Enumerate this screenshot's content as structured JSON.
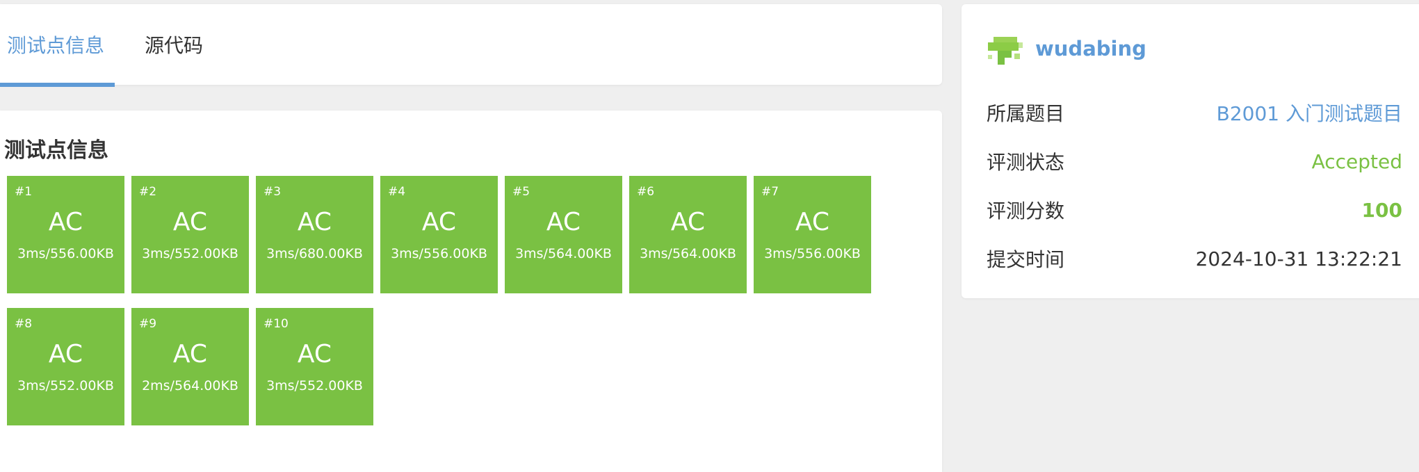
{
  "tabs": {
    "testpoints_label": "测试点信息",
    "source_label": "源代码"
  },
  "points_section": {
    "title": "测试点信息",
    "items": [
      {
        "num": "#1",
        "status": "AC",
        "stat": "3ms/556.00KB"
      },
      {
        "num": "#2",
        "status": "AC",
        "stat": "3ms/552.00KB"
      },
      {
        "num": "#3",
        "status": "AC",
        "stat": "3ms/680.00KB"
      },
      {
        "num": "#4",
        "status": "AC",
        "stat": "3ms/556.00KB"
      },
      {
        "num": "#5",
        "status": "AC",
        "stat": "3ms/564.00KB"
      },
      {
        "num": "#6",
        "status": "AC",
        "stat": "3ms/564.00KB"
      },
      {
        "num": "#7",
        "status": "AC",
        "stat": "3ms/556.00KB"
      },
      {
        "num": "#8",
        "status": "AC",
        "stat": "3ms/552.00KB"
      },
      {
        "num": "#9",
        "status": "AC",
        "stat": "2ms/564.00KB"
      },
      {
        "num": "#10",
        "status": "AC",
        "stat": "3ms/552.00KB"
      }
    ]
  },
  "submission": {
    "username": "wudabing",
    "rows": [
      {
        "label": "所属题目",
        "value": "B2001 入门测试题目"
      },
      {
        "label": "评测状态",
        "value": "Accepted"
      },
      {
        "label": "评测分数",
        "value": "100"
      },
      {
        "label": "提交时间",
        "value": "2024-10-31 13:22:21"
      }
    ]
  },
  "colors": {
    "accent_blue": "#5e9ad6",
    "ac_green": "#7ac143",
    "background": "#efefef"
  }
}
